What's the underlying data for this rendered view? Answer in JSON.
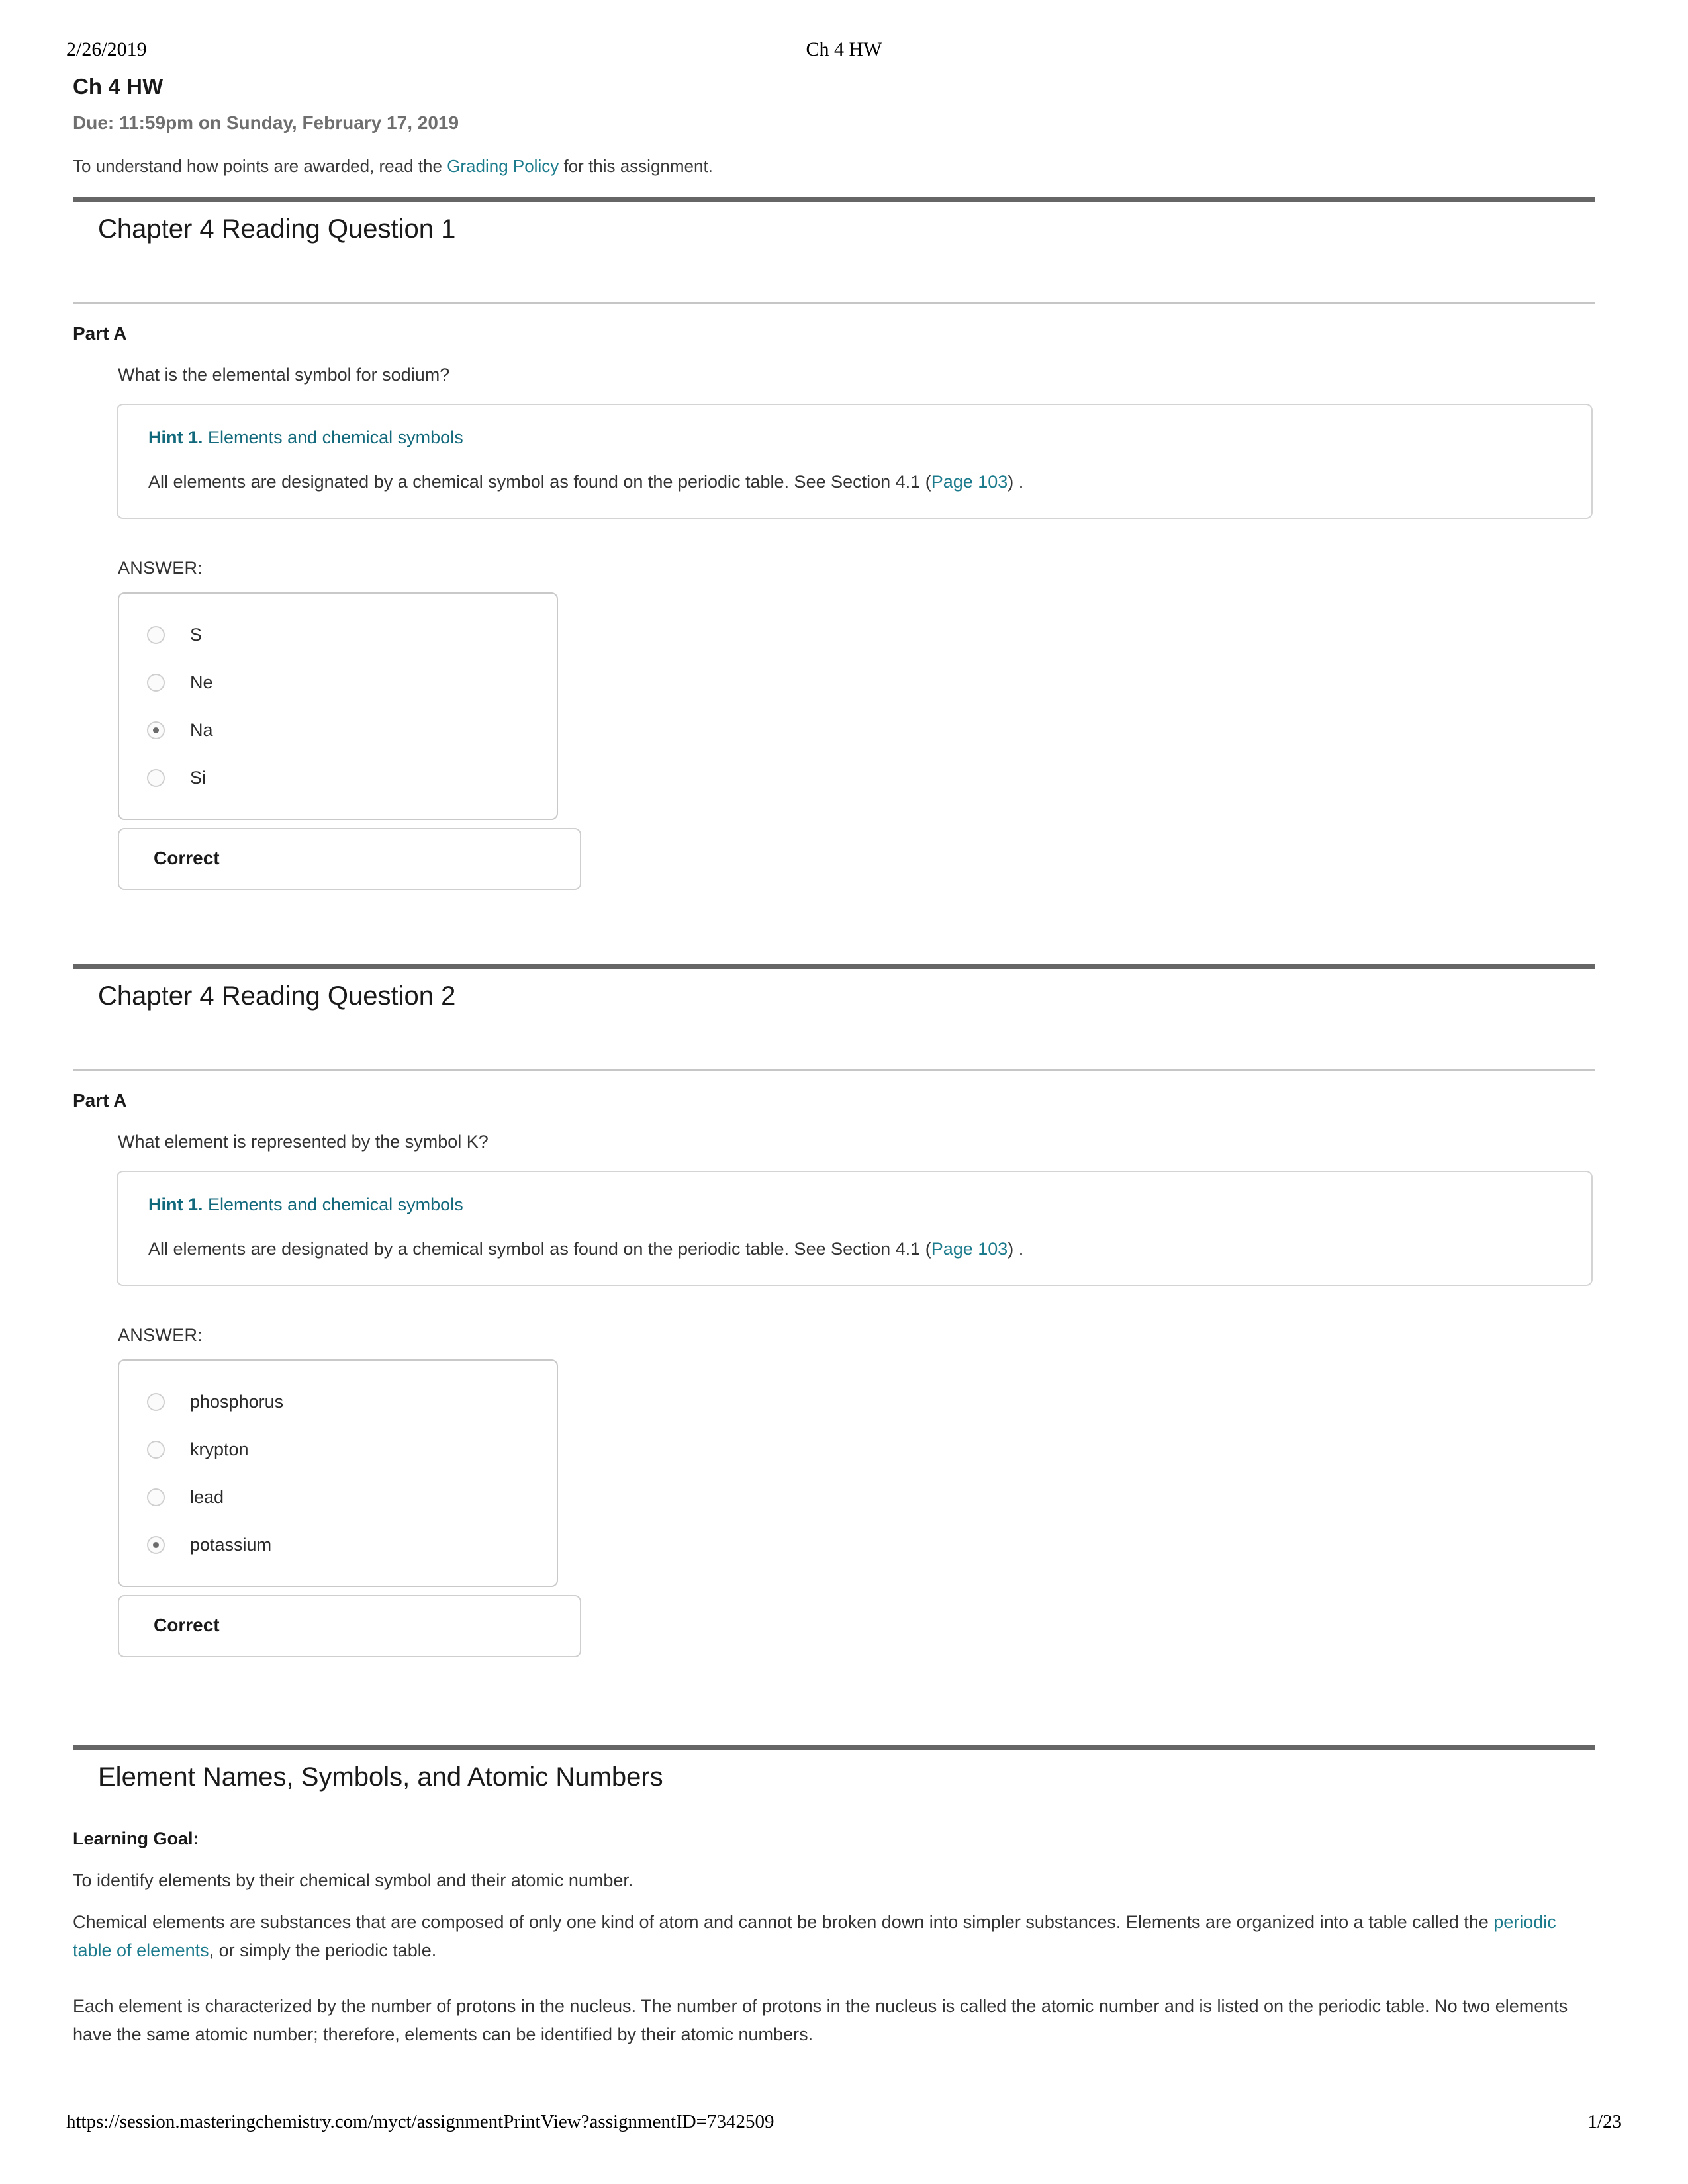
{
  "print_header": {
    "date": "2/26/2019",
    "document_title": "Ch 4 HW"
  },
  "assignment": {
    "title": "Ch 4 HW",
    "due": "Due: 11:59pm on Sunday, February 17, 2019",
    "note_before": "To understand how points are awarded, read the ",
    "note_link": "Grading Policy",
    "note_after": " for this assignment."
  },
  "sections": [
    {
      "title": "Chapter 4 Reading Question 1",
      "part_label": "Part A",
      "question": "What is the elemental symbol for sodium?",
      "hint": {
        "number": "Hint 1.",
        "title": "Elements and chemical symbols",
        "body_before": "All elements are designated by a chemical symbol as found on the periodic table. See Section 4.1 (",
        "body_link": "Page 103",
        "body_after": ") ."
      },
      "answer_label": "ANSWER:",
      "choices": [
        {
          "label": "S",
          "selected": false
        },
        {
          "label": "Ne",
          "selected": false
        },
        {
          "label": "Na",
          "selected": true
        },
        {
          "label": "Si",
          "selected": false
        }
      ],
      "result": "Correct"
    },
    {
      "title": "Chapter 4 Reading Question 2",
      "part_label": "Part A",
      "question": "What element is represented by the symbol K?",
      "hint": {
        "number": "Hint 1.",
        "title": "Elements and chemical symbols",
        "body_before": "All elements are designated by a chemical symbol as found on the periodic table. See Section 4.1 (",
        "body_link": "Page 103",
        "body_after": ") ."
      },
      "answer_label": "ANSWER:",
      "choices": [
        {
          "label": "phosphorus",
          "selected": false
        },
        {
          "label": "krypton",
          "selected": false
        },
        {
          "label": "lead",
          "selected": false
        },
        {
          "label": "potassium",
          "selected": true
        }
      ],
      "result": "Correct"
    }
  ],
  "tutorial": {
    "title": "Element Names, Symbols, and Atomic Numbers",
    "learning_goal_label": "Learning Goal:",
    "learning_goal_text": "To identify elements by their chemical symbol and their atomic number.",
    "para1_before": "Chemical elements are substances that are composed of only one kind of atom and cannot be broken down into simpler substances. Elements are organized into a table called the ",
    "para1_link": "periodic table of elements",
    "para1_after": ", or simply the periodic table.",
    "para2": "Each element is characterized by the number of protons in the nucleus. The number of protons in the nucleus is called the atomic number and is listed on the periodic table. No two elements have the same atomic number; therefore, elements can be identified by their atomic numbers."
  },
  "footer": {
    "url": "https://session.masteringchemistry.com/myct/assignmentPrintView?assignmentID=7342509",
    "page": "1/23"
  },
  "colors": {
    "link": "#1b7b8c",
    "hint_title": "#13697c",
    "section_rule": "#666666",
    "part_rule": "#c6c6c6"
  }
}
